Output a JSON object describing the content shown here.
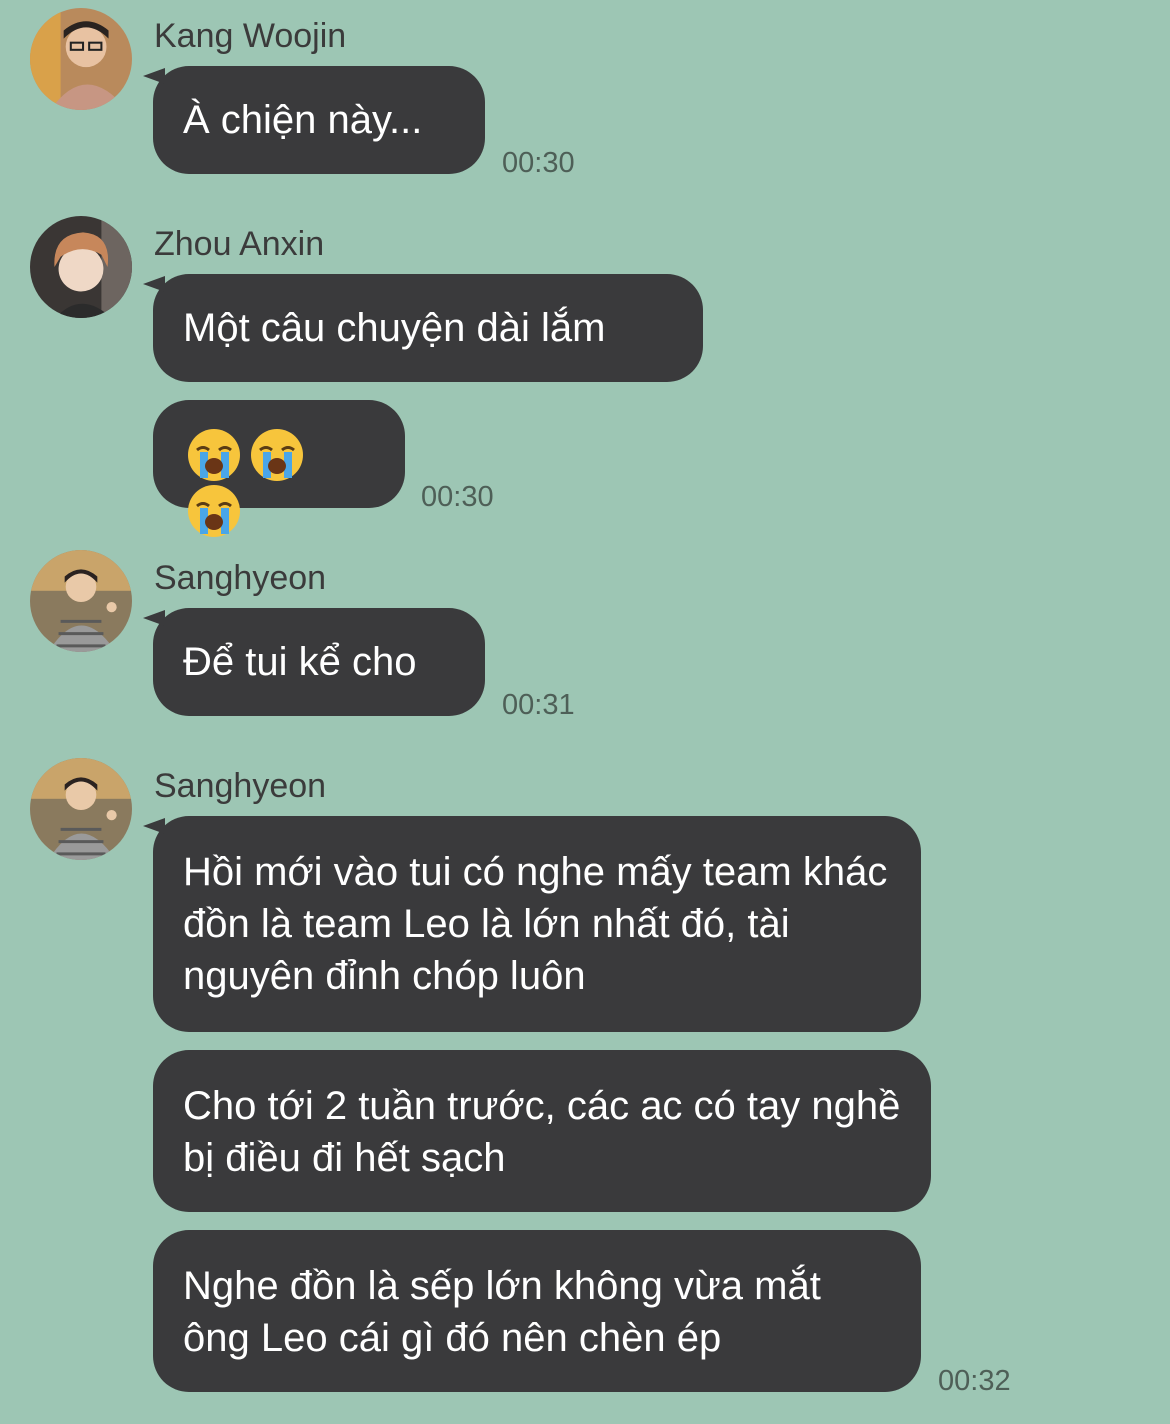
{
  "messages": [
    {
      "sender": "Kang Woojin",
      "avatar": "avatar-kang-woojin",
      "bubbles": [
        "À chiện này..."
      ],
      "time": "00:30"
    },
    {
      "sender": "Zhou Anxin",
      "avatar": "avatar-zhou-anxin",
      "bubbles": [
        "Một câu chuyện dài lắm",
        "😭😭😭"
      ],
      "time": "00:30"
    },
    {
      "sender": "Sanghyeon",
      "avatar": "avatar-sanghyeon",
      "bubbles": [
        "Để tui kể cho"
      ],
      "time": "00:31"
    },
    {
      "sender": "Sanghyeon",
      "avatar": "avatar-sanghyeon",
      "bubbles": [
        "Hồi mới vào tui có nghe mấy team khác đồn là team Leo là lớn nhất đó, tài nguyên đỉnh chóp luôn",
        "Cho tới 2 tuần trước, các ac có tay nghề bị điều đi hết sạch",
        "Nghe đồn là sếp lớn không vừa mắt ông Leo cái gì đó nên chèn ép"
      ],
      "time": "00:32"
    }
  ],
  "colors": {
    "background": "#9dc6b4",
    "bubble": "#3a3a3c",
    "bubble_text": "#ffffff",
    "name": "#3b3b3b",
    "time": "#4e5f57"
  }
}
